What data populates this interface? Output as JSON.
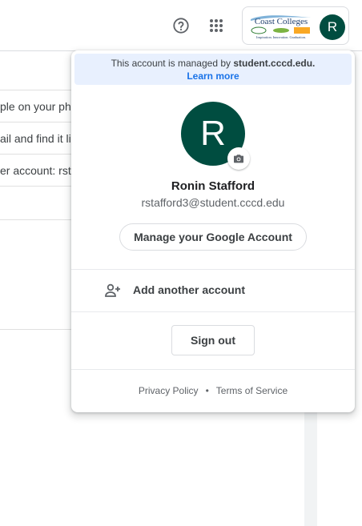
{
  "header": {
    "help_icon": "help-circle-icon",
    "apps_icon": "apps-grid-icon",
    "org_logo": {
      "name": "Coast Colleges",
      "tagline": "Inspiration. Innovation. Graduation."
    },
    "avatar_initial": "R"
  },
  "background": {
    "rows": [
      "ple on your pho",
      "ail and find it li",
      "er account: rst"
    ]
  },
  "account_popup": {
    "managed_notice": "This account is managed by",
    "managed_domain": "student.cccd.edu.",
    "learn_more": "Learn more",
    "avatar_initial": "R",
    "camera_icon": "camera-icon",
    "name": "Ronin Stafford",
    "email": "rstafford3@student.cccd.edu",
    "manage_button": "Manage your Google Account",
    "add_account_icon": "person-add-icon",
    "add_account": "Add another account",
    "sign_out": "Sign out",
    "footer": {
      "privacy": "Privacy Policy",
      "separator": "•",
      "terms": "Terms of Service"
    }
  },
  "colors": {
    "avatar_bg": "#004d40",
    "link": "#1a73e8",
    "managed_bg": "#e8f0fe"
  }
}
